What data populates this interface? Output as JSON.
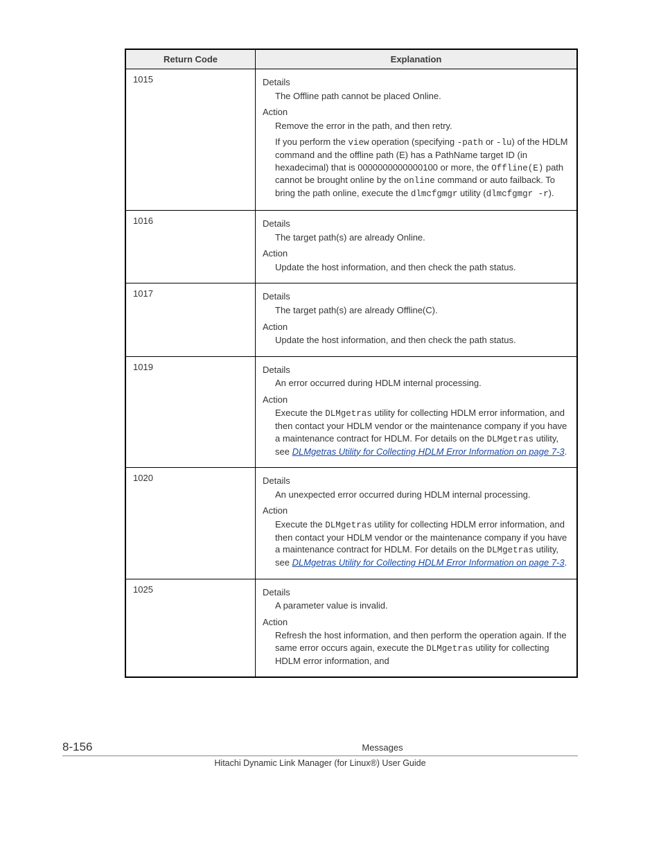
{
  "table": {
    "headers": {
      "code": "Return Code",
      "explanation": "Explanation"
    },
    "labels": {
      "details": "Details",
      "action": "Action"
    }
  },
  "rows": {
    "r1015": {
      "code": "1015",
      "details": "The Offline path cannot be placed Online.",
      "action": "Remove the error in the path, and then retry.",
      "note": {
        "a": "If you perform the ",
        "b": "view",
        "c": " operation (specifying ",
        "d": "-path",
        "e": " or ",
        "f": "-lu",
        "g": ") of the HDLM command and the offline path (E) has a PathName target ID (in hexadecimal) that is 0000000000000100 or more, the ",
        "h": "Offline(E)",
        "i": " path cannot be brought online by the ",
        "j": "online",
        "k": " command or auto failback. To bring the path online, execute the ",
        "l": "dlmcfgmgr",
        "m": " utility (",
        "n": "dlmcfgmgr -r",
        "o": ")."
      }
    },
    "r1016": {
      "code": "1016",
      "details": "The target path(s) are already Online.",
      "action": "Update the host information, and then check the path status."
    },
    "r1017": {
      "code": "1017",
      "details": "The target path(s) are already Offline(C).",
      "action": "Update the host information, and then check the path status."
    },
    "r1019": {
      "code": "1019",
      "details": "An error occurred during HDLM internal processing.",
      "action": {
        "a": "Execute the ",
        "b": "DLMgetras",
        "c": " utility for collecting HDLM error information, and then contact your HDLM vendor or the maintenance company if you have a maintenance contract for HDLM. For details on the ",
        "d": "DLMgetras",
        "e": " utility, see ",
        "link": "DLMgetras Utility for Collecting HDLM Error Information on page 7-3",
        "f": "."
      }
    },
    "r1020": {
      "code": "1020",
      "details": "An unexpected error occurred during HDLM internal processing.",
      "action": {
        "a": "Execute the ",
        "b": "DLMgetras",
        "c": " utility for collecting HDLM error information, and then contact your HDLM vendor or the maintenance company if you have a maintenance contract for HDLM. For details on the ",
        "d": "DLMgetras",
        "e": " utility, see ",
        "link": "DLMgetras Utility for Collecting HDLM Error Information on page 7-3",
        "f": "."
      }
    },
    "r1025": {
      "code": "1025",
      "details": "A parameter value is invalid.",
      "action": {
        "a": "Refresh the host information, and then perform the operation again. If the same error occurs again, execute the ",
        "b": "DLMgetras",
        "c": " utility for collecting HDLM error information, and"
      }
    }
  },
  "footer": {
    "page": "8-156",
    "title": "Messages",
    "sub": "Hitachi Dynamic Link Manager (for Linux®) User Guide"
  }
}
